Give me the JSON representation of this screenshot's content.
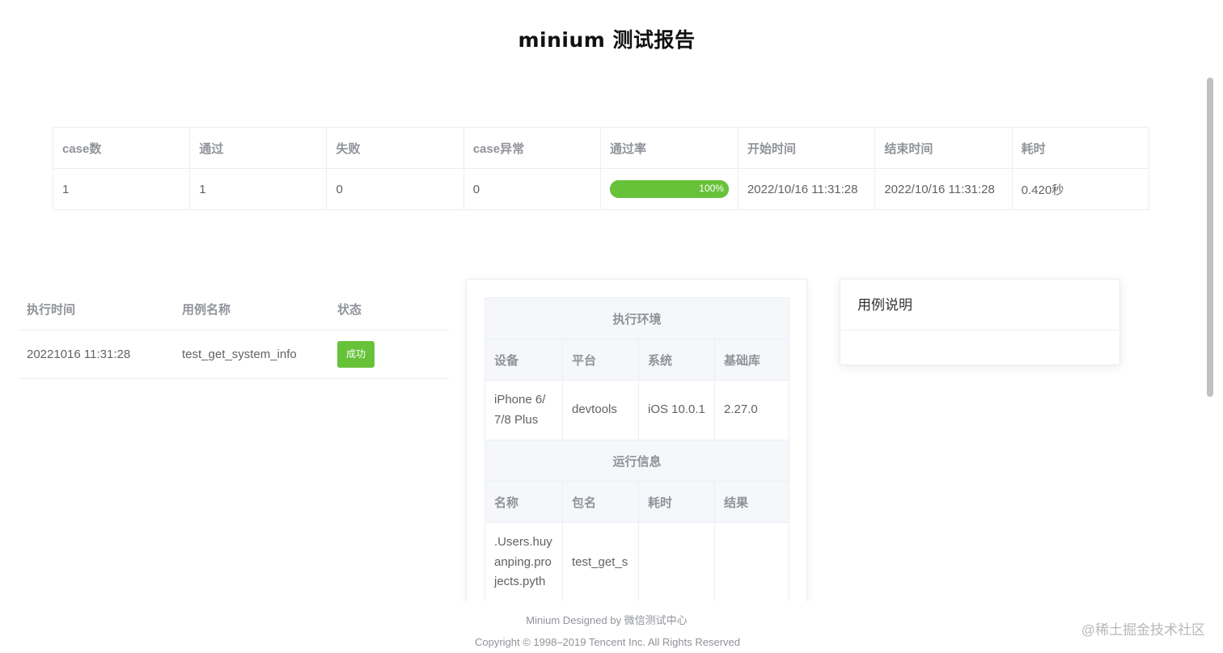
{
  "title": "minium 测试报告",
  "summary": {
    "headers": [
      "case数",
      "通过",
      "失败",
      "case异常",
      "通过率",
      "开始时间",
      "结束时间",
      "耗时"
    ],
    "case_count": "1",
    "passed": "1",
    "failed": "0",
    "errors": "0",
    "pass_rate": "100%",
    "pass_rate_value": 100,
    "start_time": "2022/10/16 11:31:28",
    "end_time": "2022/10/16 11:31:28",
    "duration": "0.420秒"
  },
  "cases": {
    "headers": [
      "执行时间",
      "用例名称",
      "状态"
    ],
    "rows": [
      {
        "time": "20221016 11:31:28",
        "name": "test_get_system_info",
        "status": "成功"
      }
    ]
  },
  "env": {
    "section1_title": "执行环境",
    "section1_headers": [
      "设备",
      "平台",
      "系统",
      "基础库"
    ],
    "device": "iPhone 6/7/8 Plus",
    "platform": "devtools",
    "system": "iOS 10.0.1",
    "sdk": "2.27.0",
    "section2_title": "运行信息",
    "section2_headers": [
      "名称",
      "包名",
      "耗时",
      "结果"
    ],
    "run_name": ".Users.huyanping.projects.pyth",
    "run_package": "test_get_s"
  },
  "description": {
    "title": "用例说明"
  },
  "footer": {
    "line1": "Minium Designed by 微信测试中心",
    "line2": "Copyright © 1998–2019 Tencent Inc. All Rights Reserved"
  },
  "watermark": "@稀土掘金技术社区",
  "colors": {
    "success": "#67c23a",
    "header_bg": "#f5f7fa",
    "border": "#ebeef5"
  }
}
